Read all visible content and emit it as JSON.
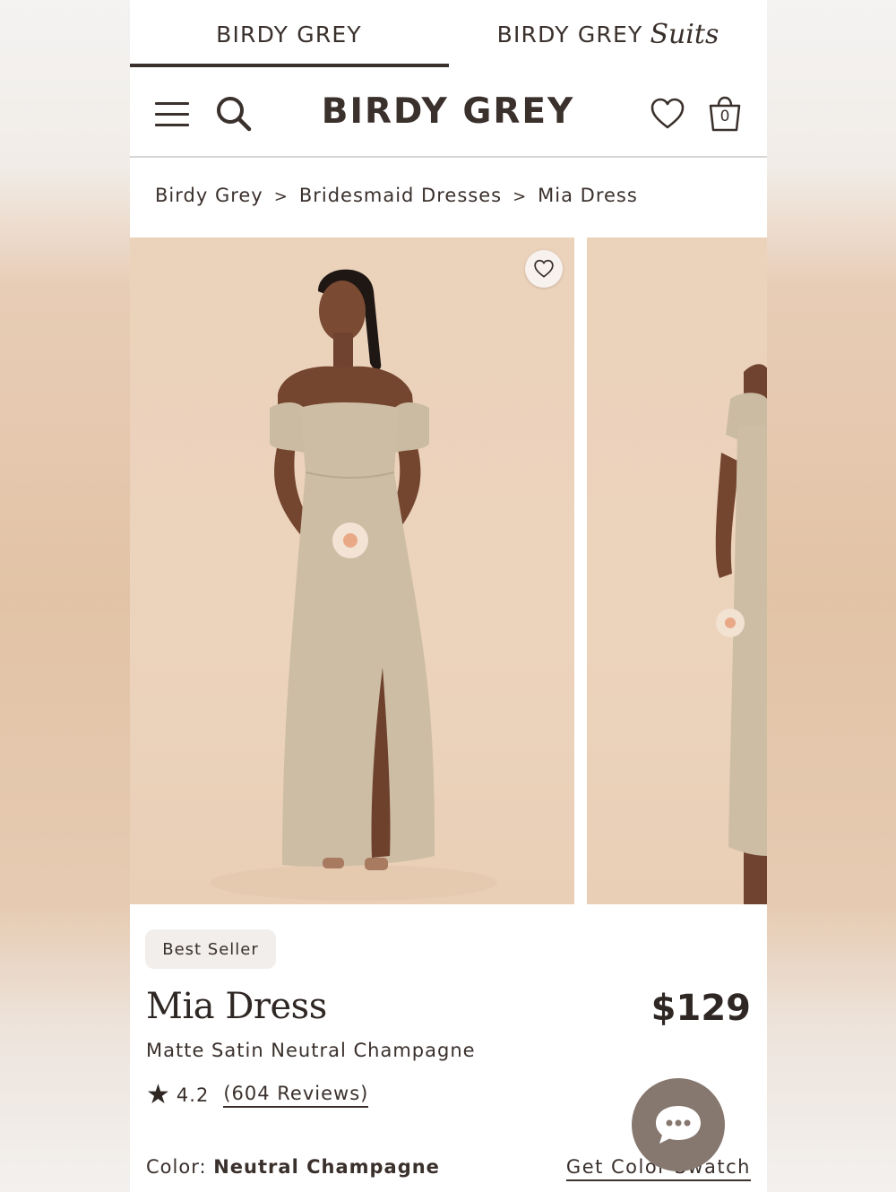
{
  "brand_tabs": {
    "birdy_grey": "BIRDY GREY",
    "suits_prefix": "BIRDY GREY",
    "suits_word": "Suits"
  },
  "header": {
    "logo": "BIRDY GREY",
    "cart_count": "0",
    "icons": [
      "menu-icon",
      "search-icon",
      "heart-icon",
      "shopping-bag-icon"
    ]
  },
  "breadcrumb": {
    "items": [
      "Birdy Grey",
      "Bridesmaid Dresses",
      "Mia Dress"
    ],
    "separator": ">"
  },
  "product": {
    "badge": "Best Seller",
    "title": "Mia Dress",
    "price": "$129",
    "subtitle": "Matte Satin Neutral Champagne",
    "rating": "4.2",
    "reviews": "(604 Reviews)",
    "color_label": "Color:",
    "color_value": "Neutral Champagne",
    "swatch_link": "Get Color Swatch"
  },
  "colors": {
    "text": "#3a302c",
    "image_bg": "#ebd2bb",
    "dress": "#cdbda4",
    "chat_button": "#86776f"
  }
}
